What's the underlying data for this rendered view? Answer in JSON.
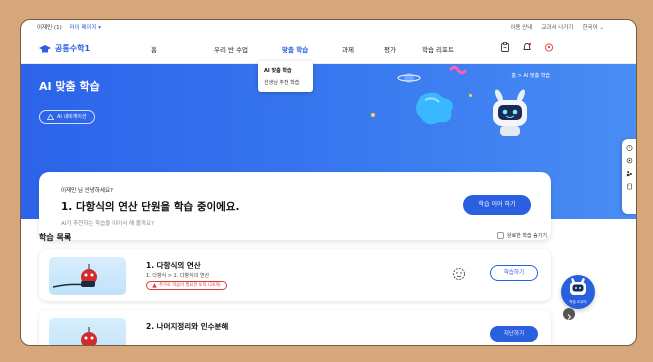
{
  "sysbar": {
    "user": "이재민 (1)",
    "my_page": "마이 페이지 ▾",
    "links": [
      "이용 안내",
      "교과서 나가기",
      "한국어 ⌄"
    ]
  },
  "nav": {
    "app_name": "공통수학1",
    "menu": [
      "홈",
      "우리 반 수업",
      "맞춤 학습",
      "과제",
      "평가",
      "학습 리포트"
    ],
    "active_index": 2,
    "icons": [
      "clipboard-icon",
      "bell-icon",
      "profile-icon"
    ]
  },
  "dropdown": {
    "items": [
      "AI 맞춤 학습",
      "선생님 추천 학습"
    ]
  },
  "hero": {
    "title": "AI 맞춤 학습",
    "ai_nav_label": "AI 내비게이션",
    "breadcrumb": "홈 > AI 맞춤 학습"
  },
  "card": {
    "greeting": "이재민 님 안녕하세요?",
    "headline": "1. 다항식의 연산 단원을 학습 중이에요.",
    "subtext": "AI가 추천하는 학습을 이어서 해 볼까요?",
    "cta": "학습 이어 하기"
  },
  "list": {
    "title": "학습 목록",
    "toggle_label": "완료한 학습 숨기기",
    "items": [
      {
        "title": "1. 다항식의 연산",
        "path": "1. 다항식 > 1. 다항식의 연산",
        "badge": "추가로 학습이 필요한 토픽 (16개)",
        "button": "학습하기"
      },
      {
        "title": "2. 나머지정리와 인수분해",
        "button": "지난하기"
      }
    ]
  },
  "fab": {
    "label": "학습 도우미"
  },
  "colors": {
    "primary": "#2a5fe0",
    "hero": "#3a7bf0",
    "alert": "#e23a3a",
    "background": "#d6a77a"
  }
}
